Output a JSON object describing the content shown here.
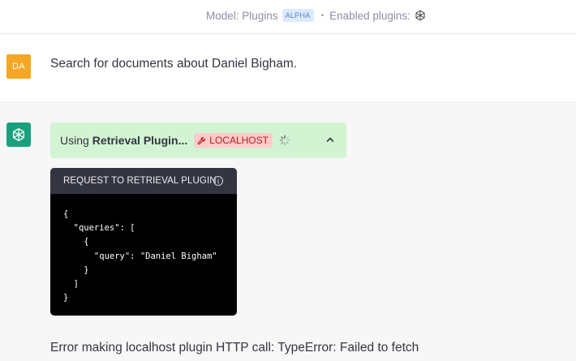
{
  "header": {
    "model_label": "Model: Plugins",
    "model_badge": "ALPHA",
    "separator": "•",
    "enabled_plugins_label": "Enabled plugins:",
    "plugin_icon": "openai-logo-icon"
  },
  "user_message": {
    "avatar_initials": "DA",
    "avatar_color": "#f5a623",
    "text": "Search for documents about Daniel Bigham."
  },
  "assistant_message": {
    "avatar_icon": "openai-logo-icon",
    "avatar_color": "#19a17c",
    "plugin_status": {
      "prefix": "Using",
      "plugin_name": "Retrieval Plugin...",
      "badge": "LOCALHOST",
      "badge_icon": "wrench-icon",
      "state": "loading",
      "toggle_icon": "chevron-up-icon",
      "background_color": "#d2f4d3"
    },
    "request_panel": {
      "title": "REQUEST TO RETRIEVAL PLUGIN",
      "info_icon": "info-icon",
      "code_lines": [
        "{",
        "  \"queries\": [",
        "    {",
        "      \"query\": \"Daniel Bigham\"",
        "    }",
        "  ]",
        "}"
      ]
    },
    "error_text": "Error making localhost plugin HTTP call: TypeError: Failed to fetch"
  }
}
